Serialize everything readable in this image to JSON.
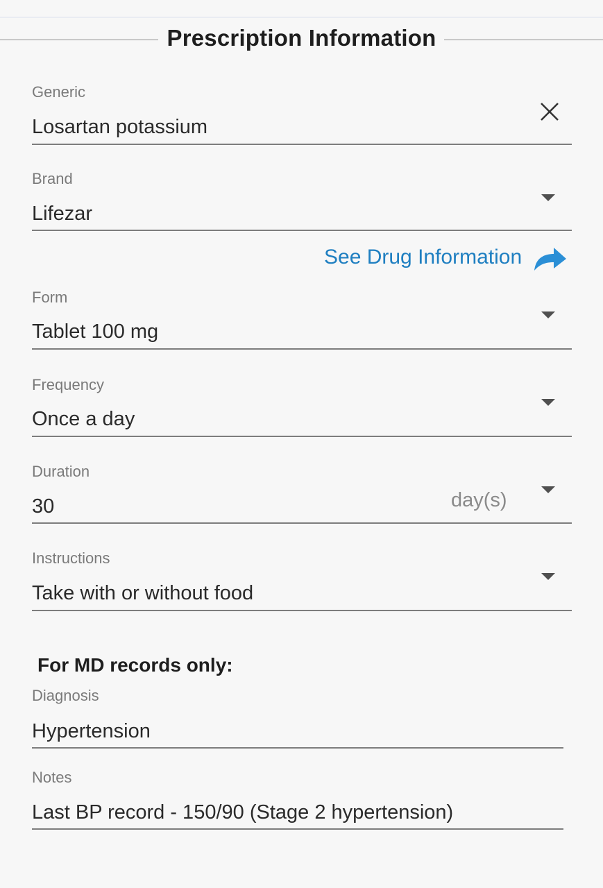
{
  "header": {
    "title": "Prescription Information"
  },
  "fields": {
    "generic": {
      "label": "Generic",
      "value": "Losartan potassium"
    },
    "brand": {
      "label": "Brand",
      "value": "Lifezar"
    },
    "form": {
      "label": "Form",
      "value": "Tablet 100 mg"
    },
    "frequency": {
      "label": "Frequency",
      "value": "Once a day"
    },
    "duration": {
      "label": "Duration",
      "value": "30",
      "unit": "day(s)"
    },
    "instructions": {
      "label": "Instructions",
      "value": "Take with or without food"
    },
    "diagnosis": {
      "label": "Diagnosis",
      "value": "Hypertension"
    },
    "notes": {
      "label": "Notes",
      "value": "Last BP record - 150/90 (Stage 2 hypertension)"
    }
  },
  "drug_info_link": "See Drug Information",
  "md_section": {
    "title": "For MD records only:"
  },
  "icons": {
    "clear": "close-icon",
    "dropdown": "chevron-down-icon",
    "link": "share-arrow-icon"
  },
  "colors": {
    "accent": "#1f7fc1",
    "background": "#f7f7f7"
  }
}
